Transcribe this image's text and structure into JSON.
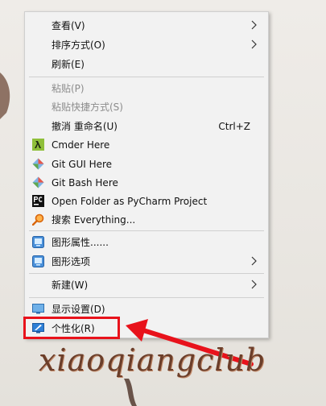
{
  "menu": {
    "items": [
      {
        "label": "查看(V)",
        "submenu": true
      },
      {
        "label": "排序方式(O)",
        "submenu": true
      },
      {
        "label": "刷新(E)"
      },
      {
        "label": "粘贴(P)",
        "disabled": true
      },
      {
        "label": "粘贴快捷方式(S)",
        "disabled": true
      },
      {
        "label": "撤消 重命名(U)",
        "shortcut": "Ctrl+Z"
      },
      {
        "label": "Cmder Here",
        "icon": "cmder-icon"
      },
      {
        "label": "Git GUI Here",
        "icon": "git-icon"
      },
      {
        "label": "Git Bash Here",
        "icon": "git-icon"
      },
      {
        "label": "Open Folder as PyCharm Project",
        "icon": "pycharm-icon"
      },
      {
        "label": "搜索 Everything...",
        "icon": "everything-search-icon"
      },
      {
        "label": "图形属性......",
        "icon": "intel-graphics-icon"
      },
      {
        "label": "图形选项",
        "icon": "intel-graphics-icon",
        "submenu": true
      },
      {
        "label": "新建(W)",
        "submenu": true
      },
      {
        "label": "显示设置(D)",
        "icon": "display-icon"
      },
      {
        "label": "个性化(R)",
        "icon": "personalize-icon"
      }
    ]
  },
  "watermark": "xiaoqiangclub",
  "colors": {
    "menu_bg": "#f2f2f2",
    "highlight": "#e8121b",
    "disabled_text": "#8c8c8c"
  }
}
